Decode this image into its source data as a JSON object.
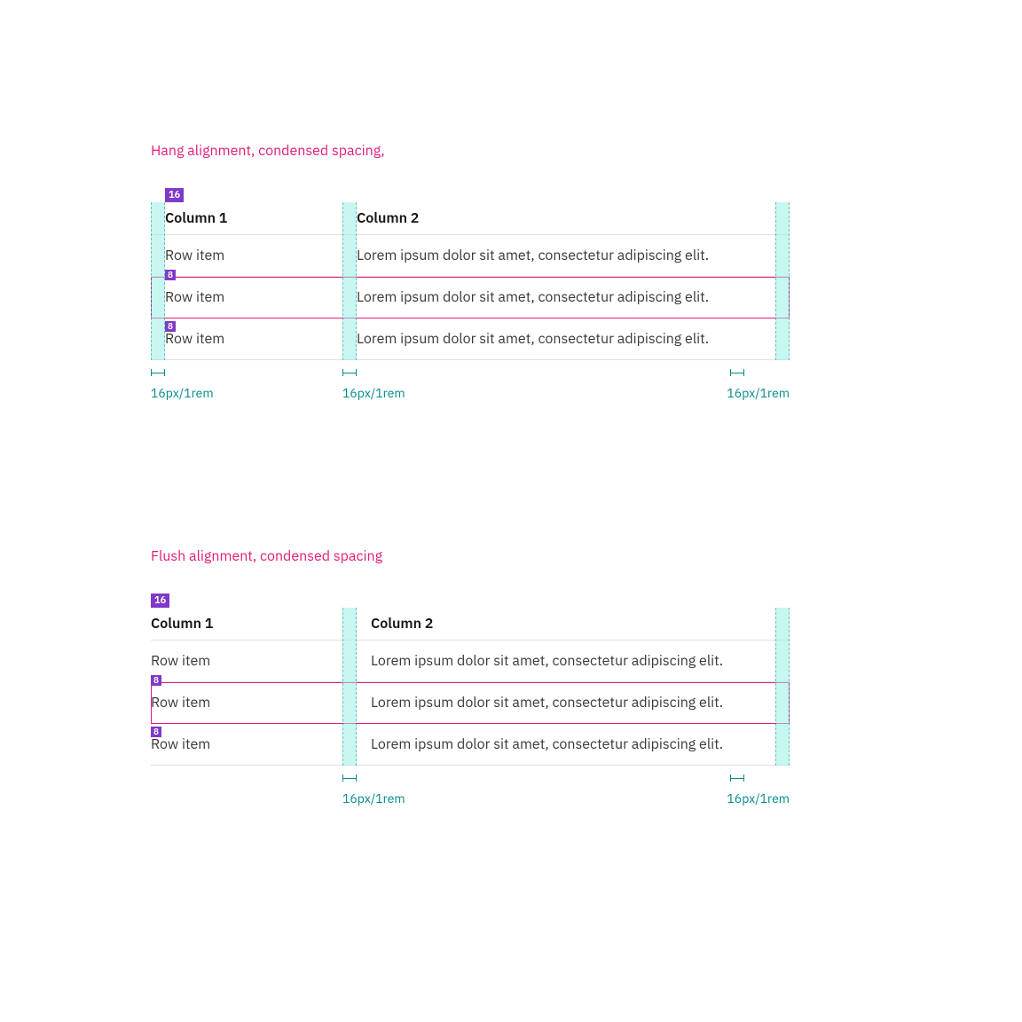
{
  "hang": {
    "caption": "Hang alignment, condensed spacing,",
    "chip": "16",
    "tiny_top": "8",
    "tiny_bottom": "8",
    "headers": [
      "Column 1",
      "Column 2"
    ],
    "rows": [
      {
        "c1": "Row item",
        "c2": "Lorem ipsum dolor sit amet, consectetur adipiscing elit."
      },
      {
        "c1": "Row item",
        "c2": "Lorem ipsum dolor sit amet, consectetur adipiscing elit."
      },
      {
        "c1": "Row item",
        "c2": "Lorem ipsum dolor sit amet, consectetur adipiscing elit."
      }
    ],
    "measure": "16px/1rem"
  },
  "flush": {
    "caption": "Flush alignment, condensed spacing",
    "chip": "16",
    "tiny_top": "8",
    "tiny_bottom": "8",
    "headers": [
      "Column 1",
      "Column 2"
    ],
    "rows": [
      {
        "c1": "Row item",
        "c2": "Lorem ipsum dolor sit amet, consectetur adipiscing elit."
      },
      {
        "c1": "Row item",
        "c2": "Lorem ipsum dolor sit amet, consectetur adipiscing elit."
      },
      {
        "c1": "Row item",
        "c2": "Lorem ipsum dolor sit amet, consectetur adipiscing elit."
      }
    ],
    "measure": "16px/1rem"
  }
}
